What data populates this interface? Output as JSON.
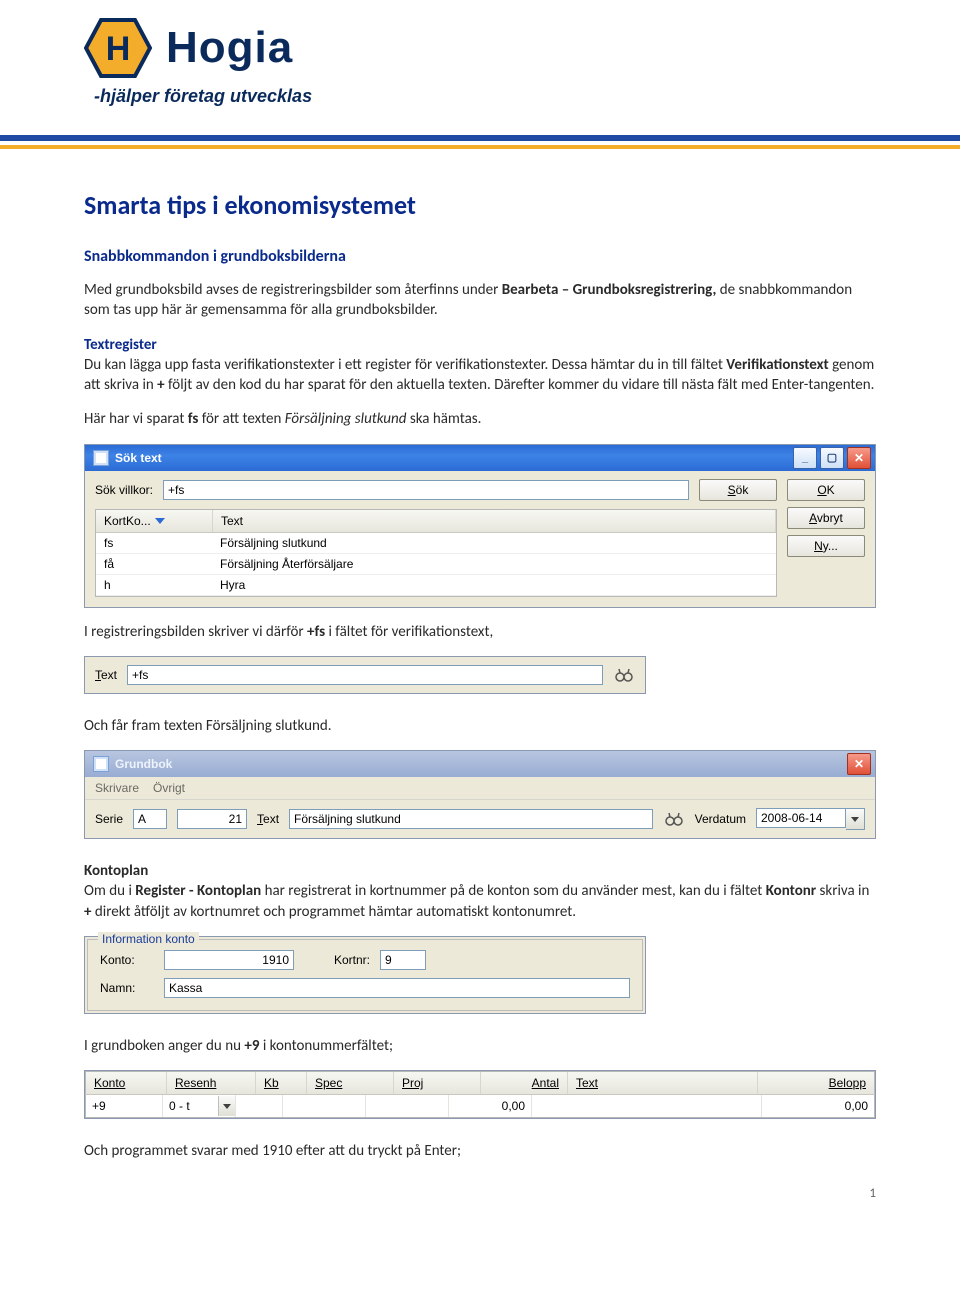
{
  "brand": {
    "name": "Hogia",
    "tagline": "-hjälper företag utvecklas",
    "logo_letter": "H",
    "colors": {
      "primary": "#0a2a5c",
      "accent_gold": "#f4ad2a",
      "rule_blue": "#1f4aa3"
    }
  },
  "doc": {
    "title": "Smarta tips i ekonomisystemet",
    "subtitle": "Snabbkommandon i grundboksbilderna",
    "intro_pre": "Med grundboksbild avses de registreringsbilder som återfinns under ",
    "intro_bold": "Bearbeta – Grundboksregistrering,",
    "intro_post": " de snabbkommandon som tas upp här är gemensamma för alla grundboksbilder.",
    "textregister_heading": "Textregister",
    "textregister_body": "Du kan lägga upp fasta verifikationstexter i ett register för verifikationstexter. Dessa hämtar du in till fältet Verifikationstext genom att skriva in + följt av den kod du har sparat för den aktuella texten. Därefter kommer du vidare till nästa fält med Enter-tangenten.",
    "textregister_bold_word": "Verifikationstext",
    "textregister_plus": "+",
    "here_pre": "Här har vi sparat ",
    "here_bold": "fs",
    "here_mid": " för att texten ",
    "here_italic": "Försäljning slutkund",
    "here_post": " ska hämtas.",
    "after_ss1_pre": "I registreringsbilden skriver vi därför ",
    "after_ss1_bold": "+fs",
    "after_ss1_post": " i fältet för verifikationstext,",
    "after_ss2": "Och får fram texten Försäljning slutkund.",
    "kontoplan_heading": "Kontoplan",
    "kontoplan_pre": "Om du i ",
    "kontoplan_bold1": "Register - Kontoplan",
    "kontoplan_mid1": " har registrerat in kortnummer på de konton som du använder mest, kan du i fältet ",
    "kontoplan_bold2": "Kontonr",
    "kontoplan_mid2": " skriva in ",
    "kontoplan_bold3": "+",
    "kontoplan_post": " direkt åtföljt av kortnumret och programmet hämtar automatiskt kontonumret.",
    "after_ss4_pre": "I grundboken anger du nu ",
    "after_ss4_bold": "+9",
    "after_ss4_post": " i kontonummerfältet;",
    "after_ss5": "Och programmet svarar med 1910 efter att du tryckt på Enter;",
    "page_number": "1"
  },
  "ss1": {
    "title": "Sök text",
    "label_villkor": "Sök villkor:",
    "input_value": "+fs",
    "btn_search": "Sök",
    "btn_ok": "OK",
    "btn_cancel": "Avbryt",
    "btn_new": "Ny...",
    "col_kortko": "KortKo...",
    "col_text": "Text",
    "rows": [
      {
        "k": "fs",
        "t": "Försäljning slutkund"
      },
      {
        "k": "få",
        "t": "Försäljning Återförsäljare"
      },
      {
        "k": "h",
        "t": "Hyra"
      }
    ]
  },
  "ss2": {
    "label_text": "Text",
    "input_value": "+fs"
  },
  "ss3": {
    "title": "Grundbok",
    "menu1": "Skrivare",
    "menu2": "Övrigt",
    "label_serie": "Serie",
    "serie_value": "A",
    "num_value": "21",
    "label_text": "Text",
    "text_value": "Försäljning slutkund",
    "label_verdatum": "Verdatum",
    "date_value": "2008-06-14"
  },
  "ss4": {
    "legend": "Information konto",
    "label_konto": "Konto:",
    "konto_value": "1910",
    "label_kortnr": "Kortnr:",
    "kortnr_value": "9",
    "label_namn": "Namn:",
    "namn_value": "Kassa"
  },
  "ss5": {
    "col_konto": "Konto",
    "col_resenh": "Resenh",
    "col_kb": "Kb",
    "col_spec": "Spec",
    "col_proj": "Proj",
    "col_antal": "Antal",
    "col_text": "Text",
    "col_belopp": "Belopp",
    "konto_value": "+9",
    "resenh_value": "0 - t",
    "antal_value": "0,00",
    "belopp_value": "0,00"
  }
}
